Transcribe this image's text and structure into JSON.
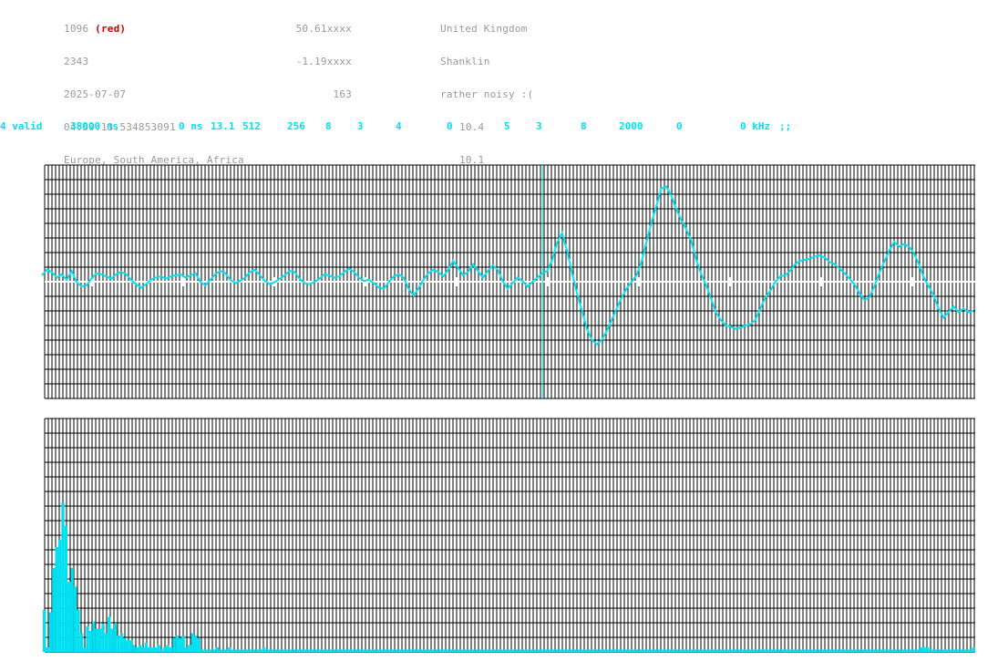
{
  "header": {
    "col1": [
      "1096",
      "2343",
      "2025-07-07",
      "04:59:13.534853091",
      "Europe, South America, Africa"
    ],
    "col1_suffix": "(red)",
    "col2": [
      "50.61xxxx",
      "-1.19xxxx",
      "163"
    ],
    "col3": [
      "United Kingdom",
      "Shanklin",
      "rather noisy :(",
      "10.4",
      "10.1"
    ]
  },
  "status": {
    "items": [
      "4 valid",
      "38000 ns",
      "0 ns",
      "13.1",
      "512",
      "256",
      "8",
      "3",
      "4",
      "0",
      "5",
      "3",
      "8",
      "2000",
      "0",
      "0 kHz",
      ";;"
    ]
  },
  "colors": {
    "trace": "#00e0f0",
    "grid": "#000000",
    "header_text": "#9a9a9a",
    "highlight": "#cc0000"
  },
  "waveform": {
    "trigger_fraction": 0.535,
    "samples": [
      0.0,
      0.05,
      0.03,
      -0.02,
      0.01,
      -0.04,
      0.04,
      -0.06,
      -0.1,
      -0.09,
      -0.03,
      0.02,
      0.01,
      -0.01,
      -0.03,
      0.01,
      0.03,
      0.01,
      -0.04,
      -0.08,
      -0.11,
      -0.08,
      -0.04,
      -0.02,
      -0.01,
      -0.03,
      -0.01,
      0.0,
      0.01,
      -0.02,
      0.0,
      0.02,
      -0.06,
      -0.09,
      -0.04,
      0.01,
      0.04,
      0.02,
      -0.04,
      -0.07,
      -0.05,
      -0.02,
      0.03,
      0.05,
      0.0,
      -0.05,
      -0.08,
      -0.06,
      -0.03,
      0.0,
      0.04,
      0.03,
      -0.03,
      -0.07,
      -0.08,
      -0.06,
      -0.03,
      0.01,
      0.0,
      -0.02,
      -0.01,
      0.03,
      0.06,
      0.03,
      -0.02,
      -0.05,
      -0.04,
      -0.07,
      -0.11,
      -0.12,
      -0.06,
      -0.01,
      0.01,
      -0.02,
      -0.12,
      -0.18,
      -0.12,
      -0.04,
      0.02,
      0.05,
      0.03,
      -0.01,
      0.05,
      0.13,
      0.07,
      0.0,
      0.03,
      0.1,
      0.04,
      -0.02,
      0.04,
      0.09,
      0.05,
      -0.05,
      -0.12,
      -0.07,
      -0.02,
      -0.05,
      -0.1,
      -0.06,
      -0.02,
      0.02,
      0.04,
      0.14,
      0.3,
      0.38,
      0.22,
      0.02,
      -0.16,
      -0.32,
      -0.48,
      -0.58,
      -0.62,
      -0.58,
      -0.5,
      -0.4,
      -0.3,
      -0.2,
      -0.12,
      -0.06,
      0.0,
      0.12,
      0.3,
      0.47,
      0.62,
      0.78,
      0.8,
      0.72,
      0.6,
      0.5,
      0.42,
      0.32,
      0.15,
      0.02,
      -0.08,
      -0.2,
      -0.33,
      -0.4,
      -0.45,
      -0.46,
      -0.48,
      -0.47,
      -0.45,
      -0.44,
      -0.4,
      -0.3,
      -0.2,
      -0.14,
      -0.06,
      -0.01,
      0.0,
      0.04,
      0.1,
      0.13,
      0.14,
      0.15,
      0.17,
      0.18,
      0.16,
      0.12,
      0.1,
      0.06,
      0.02,
      -0.03,
      -0.08,
      -0.16,
      -0.22,
      -0.2,
      -0.1,
      0.02,
      0.12,
      0.22,
      0.3,
      0.26,
      0.28,
      0.26,
      0.2,
      0.1,
      -0.02,
      -0.1,
      -0.18,
      -0.3,
      -0.38,
      -0.33,
      -0.28,
      -0.33,
      -0.3,
      -0.33,
      -0.32
    ]
  },
  "spectrum": {
    "values": [
      0.18,
      0.02,
      0.17,
      0.36,
      0.45,
      0.48,
      0.64,
      0.54,
      0.3,
      0.36,
      0.28,
      0.18,
      0.08,
      0.02,
      0.11,
      0.09,
      0.13,
      0.1,
      0.1,
      0.12,
      0.08,
      0.15,
      0.1,
      0.12,
      0.07,
      0.08,
      0.06,
      0.05,
      0.05,
      0.03,
      0.02,
      0.03,
      0.02,
      0.04,
      0.02,
      0.02,
      0.02,
      0.03,
      0.01,
      0.02,
      0.03,
      0.02,
      0.06,
      0.07,
      0.06,
      0.07,
      0.02,
      0.03,
      0.08,
      0.07,
      0.06,
      0.01,
      0.01,
      0.01,
      0.01,
      0.01,
      0.02,
      0.01,
      0.01,
      0.01,
      0.02,
      0.01,
      0.01,
      0.01,
      0.01,
      0.01,
      0.01,
      0.01,
      0.01,
      0.01,
      0.01,
      0.02,
      0.01,
      0.01,
      0.01,
      0.01,
      0.01,
      0.01,
      0.01,
      0.01,
      0.01,
      0.01,
      0.01,
      0.01,
      0.01,
      0.01,
      0.01,
      0.01,
      0.01,
      0.01,
      0.01,
      0.01,
      0.01,
      0.01,
      0.01,
      0.01,
      0.01,
      0.01,
      0.01,
      0.01,
      0.01,
      0.01,
      0.01,
      0.01,
      0.01,
      0.01,
      0.01,
      0.01,
      0.01,
      0.01,
      0.01,
      0.01,
      0.01,
      0.01,
      0.01,
      0.01,
      0.01,
      0.01,
      0.01,
      0.01,
      0.01,
      0.01,
      0.01,
      0.01,
      0.01,
      0.01,
      0.01,
      0.01,
      0.01,
      0.01,
      0.01,
      0.01,
      0.01,
      0.01,
      0.01,
      0.01,
      0.01,
      0.01,
      0.01,
      0.01,
      0.01,
      0.01,
      0.01,
      0.01,
      0.01,
      0.01,
      0.01,
      0.01,
      0.01,
      0.01,
      0.01,
      0.01,
      0.01,
      0.01,
      0.01,
      0.01,
      0.01,
      0.01,
      0.01,
      0.01,
      0.01,
      0.01,
      0.01,
      0.01,
      0.01,
      0.01,
      0.01,
      0.01,
      0.01,
      0.01,
      0.01,
      0.01,
      0.01,
      0.01,
      0.01,
      0.01,
      0.01,
      0.01,
      0.01,
      0.01,
      0.01,
      0.01,
      0.01,
      0.01,
      0.01,
      0.01,
      0.01,
      0.01,
      0.01,
      0.01,
      0.01,
      0.01,
      0.01,
      0.01,
      0.01,
      0.01,
      0.01,
      0.01,
      0.01,
      0.01,
      0.01,
      0.01,
      0.01,
      0.01,
      0.01,
      0.01,
      0.01,
      0.01,
      0.01,
      0.01,
      0.01,
      0.01,
      0.01,
      0.01,
      0.01,
      0.01,
      0.01,
      0.01,
      0.01,
      0.01,
      0.01,
      0.01,
      0.01,
      0.01,
      0.01,
      0.01,
      0.01,
      0.01,
      0.01,
      0.01,
      0.01,
      0.01,
      0.01,
      0.01,
      0.01,
      0.01,
      0.01,
      0.01,
      0.01,
      0.01,
      0.01,
      0.01,
      0.01,
      0.01,
      0.01,
      0.01,
      0.01,
      0.01,
      0.01,
      0.01,
      0.01,
      0.01,
      0.01,
      0.01,
      0.01,
      0.01,
      0.01,
      0.01,
      0.01,
      0.01,
      0.01,
      0.01,
      0.01,
      0.01,
      0.01,
      0.01,
      0.01,
      0.01,
      0.01,
      0.01,
      0.01,
      0.01,
      0.01,
      0.01,
      0.01,
      0.01,
      0.01,
      0.01,
      0.01,
      0.01,
      0.01,
      0.01,
      0.01,
      0.01,
      0.02,
      0.02,
      0.02,
      0.01,
      0.01,
      0.01,
      0.01,
      0.01,
      0.01,
      0.01,
      0.01,
      0.01,
      0.01,
      0.01,
      0.01,
      0.01,
      0.01,
      0.02
    ]
  }
}
